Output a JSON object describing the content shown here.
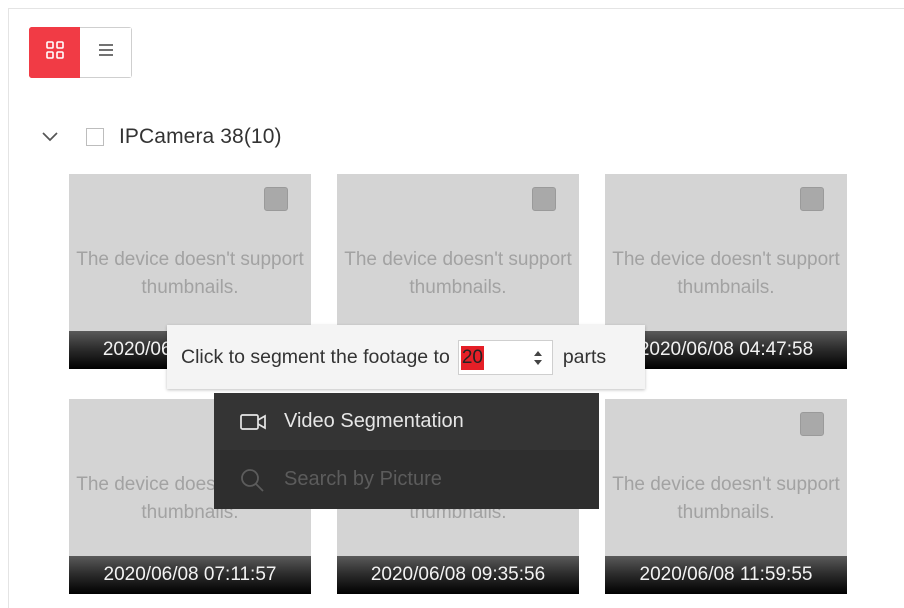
{
  "toolbar": {
    "views": [
      {
        "name": "grid-view",
        "icon": "grid-icon",
        "active": true
      },
      {
        "name": "list-view",
        "icon": "list-icon",
        "active": false
      }
    ],
    "accent_color": "#f13b45"
  },
  "group": {
    "title": "IPCamera 38(10)",
    "expanded": true,
    "checked": false
  },
  "thumbnails": [
    {
      "message": "The device doesn't support thumbnails.",
      "time": "2020/06/08 00:00:00"
    },
    {
      "message": "The device doesn't support thumbnails.",
      "time": ""
    },
    {
      "message": "The device doesn't support thumbnails.",
      "time": "2020/06/08 04:47:58"
    },
    {
      "message": "The device doesn't support thumbnails.",
      "time": "2020/06/08 07:11:57"
    },
    {
      "message": "The device doesn't support thumbnails.",
      "time": "2020/06/08 09:35:56"
    },
    {
      "message": "The device doesn't support thumbnails.",
      "time": "2020/06/08 11:59:55"
    }
  ],
  "segmentation": {
    "prefix": "Click to segment the footage to",
    "value": "20",
    "suffix": "parts"
  },
  "context_menu": {
    "items": [
      {
        "label": "Video Segmentation",
        "icon": "video-camera-icon",
        "enabled": true
      },
      {
        "label": "Search by Picture",
        "icon": "search-icon",
        "enabled": false
      }
    ]
  }
}
